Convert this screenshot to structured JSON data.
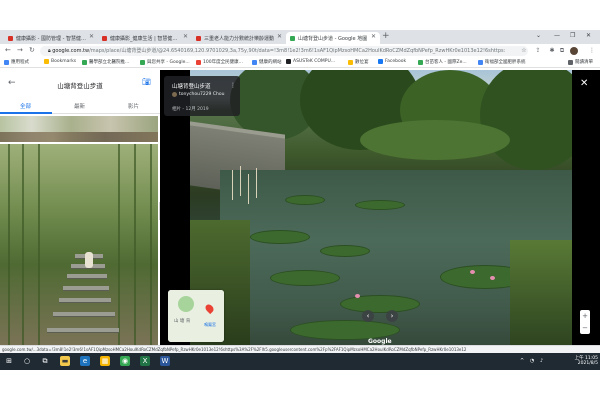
{
  "browser": {
    "tabs": [
      {
        "title": "健康攝影 - 國防管理 - 智慧健康社群",
        "fav_color": "#d93025"
      },
      {
        "title": "健康攝影_健康生活 | 智慧健康社群",
        "fav_color": "#d93025"
      },
      {
        "title": "三重老人能力分數統計樂齡運動",
        "fav_color": "#d93025"
      },
      {
        "title": "山塘背登山步道 - Google 地圖",
        "fav_color": "#34a853"
      }
    ],
    "new_tab": "+",
    "url_host": "google.com.tw",
    "url_rest": "/maps/place/山塘背登山步道/@24.6540169,120.9701029,3a,75y,90t/data=!3m8!1e2!3m6!1sAF1QipMzsoHMCa2HoulKdRoCZMdZqfbNPefp_RzwHKr0e1013e12!6shttps:",
    "avatar_label": "JS"
  },
  "bookmarks": [
    {
      "label": "應用程式",
      "color": "#4285f4"
    },
    {
      "label": "Bookmarks",
      "color": "#fbbc04"
    },
    {
      "label": "醫學部立北醫院推...",
      "color": "#34a853"
    },
    {
      "label": "與您共享 - Google...",
      "color": "#34a853"
    },
    {
      "label": "100年度全民健康...",
      "color": "#ea4335"
    },
    {
      "label": "健康的網站",
      "color": "#4285f4"
    },
    {
      "label": "ASUSTeK COMPU...",
      "color": "#202124"
    },
    {
      "label": "數位宴",
      "color": "#fbbc04"
    },
    {
      "label": "Facebook",
      "color": "#1877f2"
    },
    {
      "label": "台苗客人 - 國際Ze...",
      "color": "#34a853"
    },
    {
      "label": "衛福部全國肥胖系統",
      "color": "#4285f4"
    },
    {
      "label": "閱讀清單",
      "color": "#5f6368"
    }
  ],
  "left_panel": {
    "title": "山塘背登山步道",
    "tabs": [
      "全部",
      "最新",
      "影片"
    ]
  },
  "viewer": {
    "place_name": "山塘背登山步道",
    "contributor": "tonychou7229 Chou",
    "date": "相片 - 12月 2019",
    "more": "⋮",
    "close": "✕",
    "prev": "‹",
    "next": "›",
    "zoom_in": "+",
    "zoom_out": "−",
    "google": "Google",
    "minimap_label": "山 塘 背",
    "minimap_blue": "鳴鳳宮"
  },
  "status_url": "google.com.tw/...3data=!3m8!1e2!3m6!1sAF1QipMzsoHMCa2HoulKdRoCZMdZqfbNPefp_RzwHKr0e1013e12!6shttps%3A%2F%2Flh5.googleusercontent.com%2Fp%2FAF1QipMzsoHMCa2HoulKdRoCZMdZqfbNPefp_RzwHKr0e1013e12",
  "taskbar": {
    "time": "上午 11:05",
    "date": "2021/8/5"
  }
}
